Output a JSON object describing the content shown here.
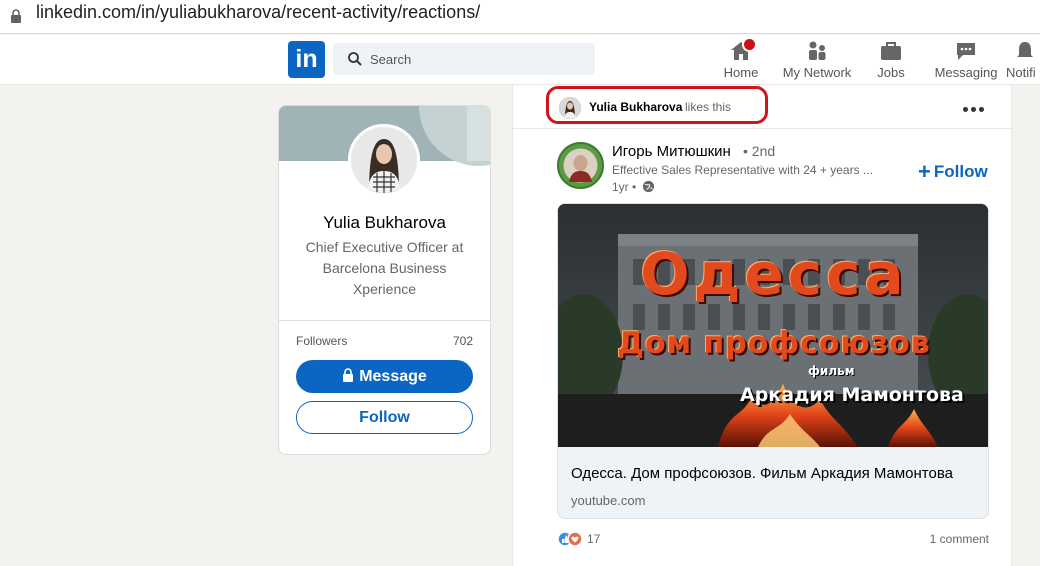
{
  "browser": {
    "url": "linkedin.com/in/yuliabukharova/recent-activity/reactions/"
  },
  "nav": {
    "logo_text": "in",
    "search_placeholder": "Search",
    "items": [
      {
        "label": "Home",
        "icon": "home-icon"
      },
      {
        "label": "My Network",
        "icon": "network-icon"
      },
      {
        "label": "Jobs",
        "icon": "briefcase-icon"
      },
      {
        "label": "Messaging",
        "icon": "chat-icon"
      },
      {
        "label": "Notifi",
        "icon": "bell-icon"
      }
    ]
  },
  "profile": {
    "name": "Yulia Bukharova",
    "headline": "Chief Executive Officer at Barcelona Business Xperience",
    "followers_label": "Followers",
    "followers_count": "702",
    "message_label": "Message",
    "follow_label": "Follow"
  },
  "post": {
    "actor_name": "Yulia Bukharova",
    "actor_action": "likes this",
    "author_name": "Игорь Митюшкин",
    "author_degree": "• 2nd",
    "author_headline": "Effective Sales Representative with 24 + years ...",
    "time": "1yr •",
    "follow_label": "Follow",
    "image_title_line1": "Одесса",
    "image_title_line2": "Дом профсоюзов",
    "image_title_line3": "фильм",
    "image_title_line4": "Аркадия Мамонтова",
    "link_title": "Одесса. Дом профсоюзов. Фильм Аркадия Мамонтова",
    "link_domain": "youtube.com",
    "reaction_count": "17",
    "comments": "1 comment"
  },
  "colors": {
    "brand": "#0a66c2",
    "highlight": "#d0141a"
  }
}
